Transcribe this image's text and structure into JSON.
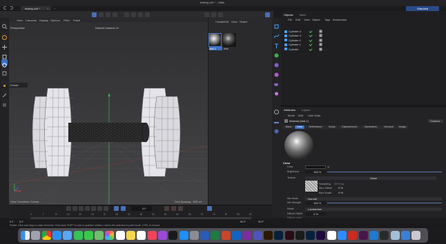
{
  "window": {
    "title": "testing.c4d * – Main",
    "tab_label": "testing.c4d *",
    "layout": "Standard"
  },
  "viewport_menu": [
    "View",
    "Cameras",
    "Display",
    "Options",
    "Filter",
    "Panel"
  ],
  "viewport": {
    "mode": "Perspective",
    "camera": "Default Camera •⊙",
    "hud_label": "Rotate",
    "transform_label": "View Transform: Scene",
    "grid_spacing": "Grid Spacing : 500 cm"
  },
  "material_manager": {
    "menu": [
      "Create",
      "Edit",
      "View",
      "Select"
    ],
    "materials": [
      {
        "name": "Mat.1"
      },
      {
        "name": "Mat"
      }
    ]
  },
  "objects_panel": {
    "tabs": [
      "Objects",
      "Takes"
    ],
    "menu": [
      "File",
      "Edit",
      "View",
      "Object",
      "Tags",
      "Bookmarks"
    ],
    "items": [
      "Cylinder.4",
      "Cylinder.3",
      "Cylinder.2",
      "Cylinder.1",
      "Cylinder"
    ]
  },
  "attributes_panel": {
    "tabs": [
      "Attributes",
      "Layers"
    ],
    "menu": [
      "Mode",
      "Edit",
      "User Data"
    ],
    "material_title": "Material [Mat.1]",
    "preset": "Custom",
    "section_tabs": [
      "Basic",
      "Color",
      "Reflectance",
      "Bump",
      "Displacement",
      "Illumination",
      "Viewport",
      "Assign"
    ],
    "active_section_tab": "Color",
    "section_heading": "Color",
    "color_label": "Color",
    "brightness_label": "Brightness",
    "brightness_value": "100 %",
    "texture_label": "Texture",
    "texture_value": "Noise",
    "sampling_label": "Sampling",
    "sampling_mode": "MIPmap",
    "blur_offset_label": "Blur Offset",
    "blur_offset_value": "0 %",
    "blur_scale_label": "Blur Scale",
    "blur_scale_value": "0 %",
    "mix_mode_label": "Mix Mode",
    "mix_mode_value": "Normal",
    "mix_strength_label": "Mix Strength",
    "mix_strength_value": "100 %",
    "model_label": "Model",
    "model_value": "Lambertian",
    "diffuse_falloff_label": "Diffuse Falloff",
    "diffuse_falloff_value": "0 %",
    "diffuse_level_label": "Diffuse Level"
  },
  "timeline": {
    "ruler": [
      "0",
      "5",
      "10",
      "15",
      "20",
      "25",
      "30",
      "35",
      "40",
      "45",
      "50",
      "55",
      "60",
      "65",
      "70",
      "75",
      "80",
      "85",
      "90"
    ],
    "start": "0 F",
    "start2": "0 F",
    "current": "0 F",
    "end": "90 F",
    "end2": "90 F"
  },
  "status_bar": "Rotate: Click and drag to rotate elements. Hold down SHIFT to add to quantize rotation / add to the selection in point mode, CTRL to remove.",
  "dock": {
    "icons": [
      "finder-icon",
      "launchpad-icon",
      "chrome-icon",
      "safari-icon",
      "mail-icon",
      "facetime-icon",
      "messages-icon",
      "maps-icon",
      "photos-icon",
      "calendar-icon",
      "notes-icon",
      "reminders-icon",
      "music-icon",
      "podcasts-icon",
      "tv-icon",
      "app-store-icon",
      "system-settings-icon",
      "word-icon",
      "excel-icon",
      "powerpoint-icon",
      "outlook-icon",
      "onenote-icon",
      "teams-icon",
      "illustrator-icon",
      "photoshop-icon",
      "indesign-icon",
      "cinema4d-icon",
      "lightroom-icon",
      "premiere-icon",
      "notion-icon",
      "zoom-icon",
      "acrobat-icon",
      "slack-icon",
      "vscode-icon",
      "terminal-icon",
      "preview-icon",
      "downloads-icon",
      "trash-icon"
    ],
    "colors": [
      "#3d8fe8",
      "#a2a2ae",
      "#e9e9e9",
      "#2c8ff4",
      "#5aa7f5",
      "#33c35a",
      "#38c84a",
      "#6fc06a",
      "#f2b84b",
      "#ffffff",
      "#f5d64c",
      "#ffffff",
      "#f2425b",
      "#9a4ad8",
      "#1a1a1a",
      "#1e8ff5",
      "#8b8b94",
      "#2a5bb8",
      "#1f7a43",
      "#c9462a",
      "#1264c2",
      "#7a2e9e",
      "#4d55b8",
      "#2c1700",
      "#06213a",
      "#2a0c16",
      "#1b1b1b",
      "#06213a",
      "#1c0b3a",
      "#ffffff",
      "#2d8cff",
      "#d12a1f",
      "#4a154b",
      "#1f7ad1",
      "#2a2a2a",
      "#a6bfd9",
      "#3a7fd6",
      "#c9c9cf"
    ],
    "badge_text": [
      "AI",
      "PS",
      "ID",
      "LR",
      "PR",
      "N",
      "S"
    ]
  }
}
